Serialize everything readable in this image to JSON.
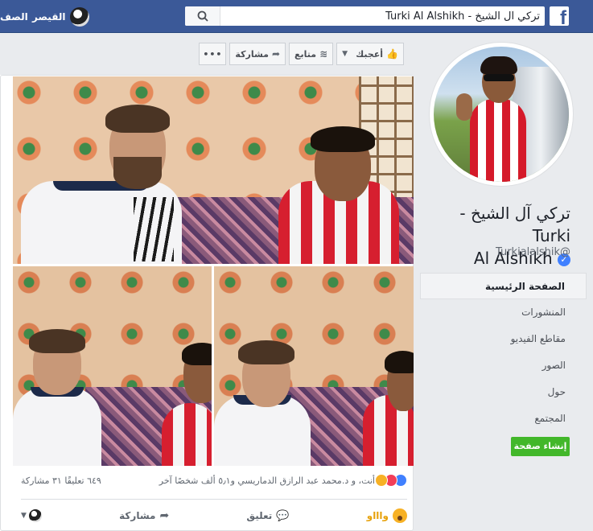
{
  "topbar": {
    "search_value": "تركي آل الشيخ - Turki Al Alshikh",
    "user_name": "القيصر",
    "home_label": "الصف",
    "logo_letter": "f",
    "icon": "facebook-logo-icon",
    "search_icon": "search-icon"
  },
  "page": {
    "name_line1": "تركي آل الشيخ - Turki",
    "name_line2": "Al Alshikh",
    "verified_mark": "✓",
    "username": "Turkialalshik@"
  },
  "nav": {
    "items": [
      {
        "label": "الصفحة الرئيسية",
        "active": true
      },
      {
        "label": "المنشورات"
      },
      {
        "label": "مقاطع الفيديو"
      },
      {
        "label": "الصور"
      },
      {
        "label": "حول"
      },
      {
        "label": "المجتمع"
      }
    ],
    "create_page": "إنشاء صفحة"
  },
  "actionbar": {
    "like": "أعجبك",
    "follow": "متابع",
    "share": "مشاركة",
    "more": "•••",
    "caret": "▼",
    "like_icon": "👍",
    "follow_icon": "≋",
    "share_icon": "➦"
  },
  "post": {
    "reactions_text": "أنت، و د.محمد عبد الرازق الدماريسي و٥٫١ ألف شخصًا آخر",
    "counts_text": "٦٤٩ تعليقًا  ٣١ مشاركة",
    "action_wow": "واااو",
    "action_comment": "تعليق",
    "action_share": "مشاركة",
    "comment_icon": "💬",
    "share_icon": "➦",
    "caret": "▼"
  },
  "colors": {
    "topbar": "#3b5998",
    "create_button": "#42b72a",
    "verified": "#4080ff"
  }
}
